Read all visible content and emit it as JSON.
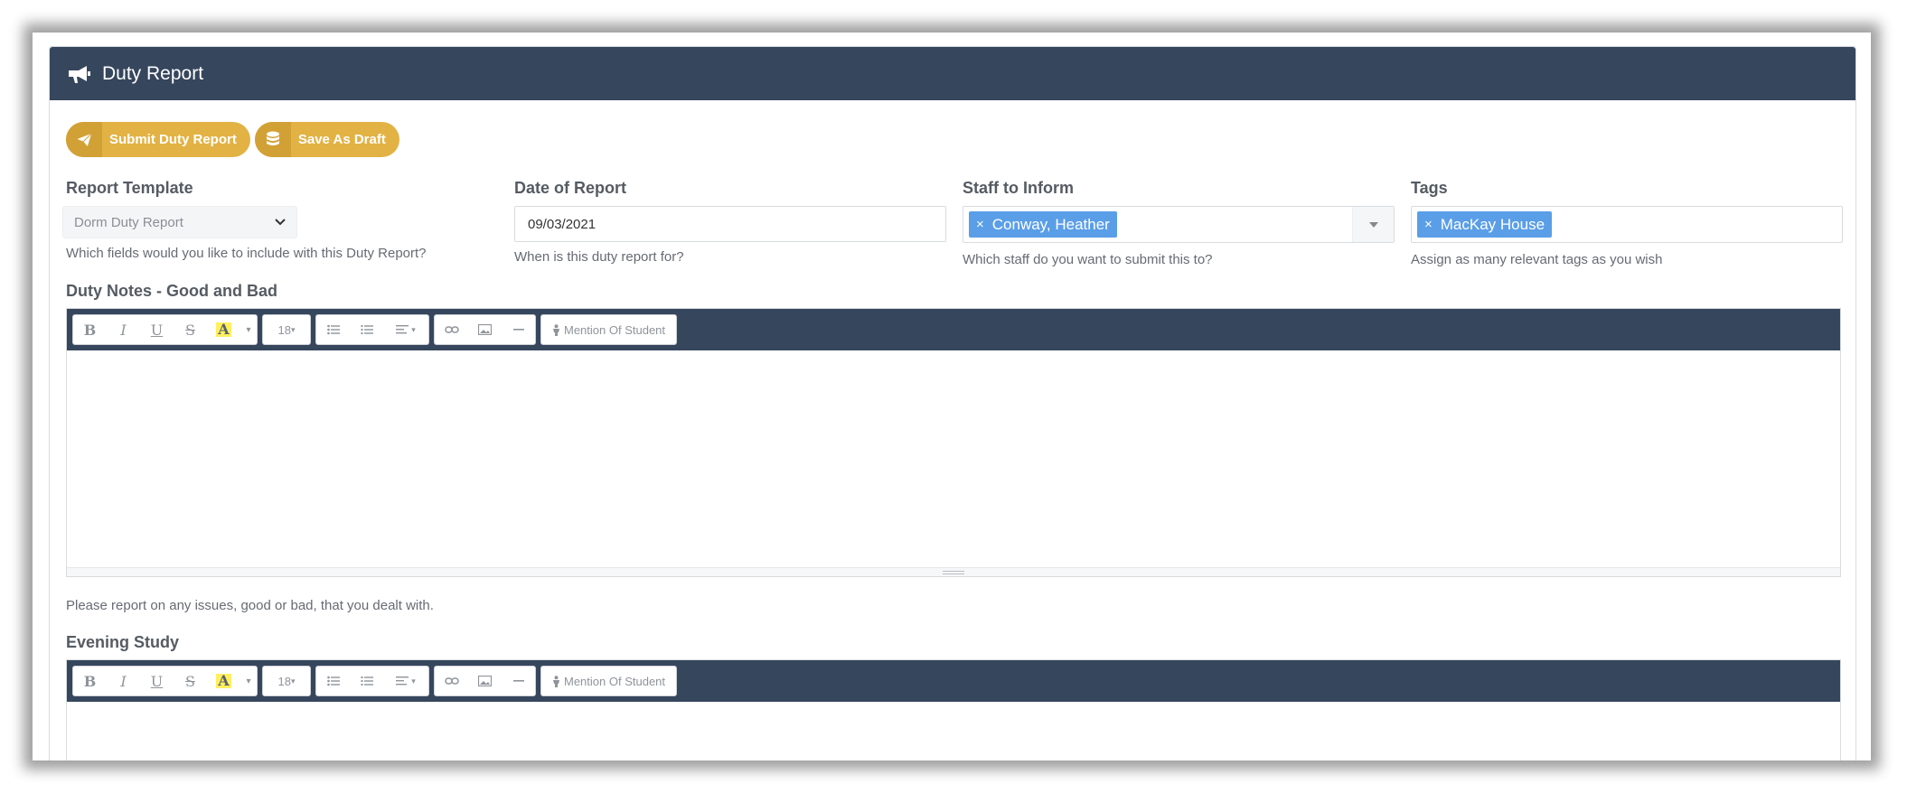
{
  "header": {
    "title": "Duty Report",
    "icon": "megaphone-icon"
  },
  "actions": {
    "submit_label": "Submit Duty Report",
    "draft_label": "Save As Draft"
  },
  "fields": {
    "report_template": {
      "label": "Report Template",
      "value": "Dorm Duty Report",
      "help": "Which fields would you like to include with this Duty Report?"
    },
    "date_of_report": {
      "label": "Date of Report",
      "value": "09/03/2021",
      "help": "When is this duty report for?"
    },
    "staff_to_inform": {
      "label": "Staff to Inform",
      "chips": [
        "Conway, Heather"
      ],
      "help": "Which staff do you want to submit this to?"
    },
    "tags": {
      "label": "Tags",
      "chips": [
        "MacKay House"
      ],
      "help": "Assign as many relevant tags as you wish"
    }
  },
  "editor_toolbar": {
    "bold": "B",
    "italic": "I",
    "underline": "U",
    "strike": "S",
    "highlight": "A",
    "font_size": "18",
    "mention_label": "Mention Of Student"
  },
  "sections": {
    "duty_notes": {
      "label": "Duty Notes - Good and Bad",
      "help": "Please report on any issues, good or bad, that you dealt with."
    },
    "evening_study": {
      "label": "Evening Study"
    }
  },
  "colors": {
    "header_bg": "#36465d",
    "accent_gold": "#e3b244",
    "chip_blue": "#5a9ee8"
  }
}
